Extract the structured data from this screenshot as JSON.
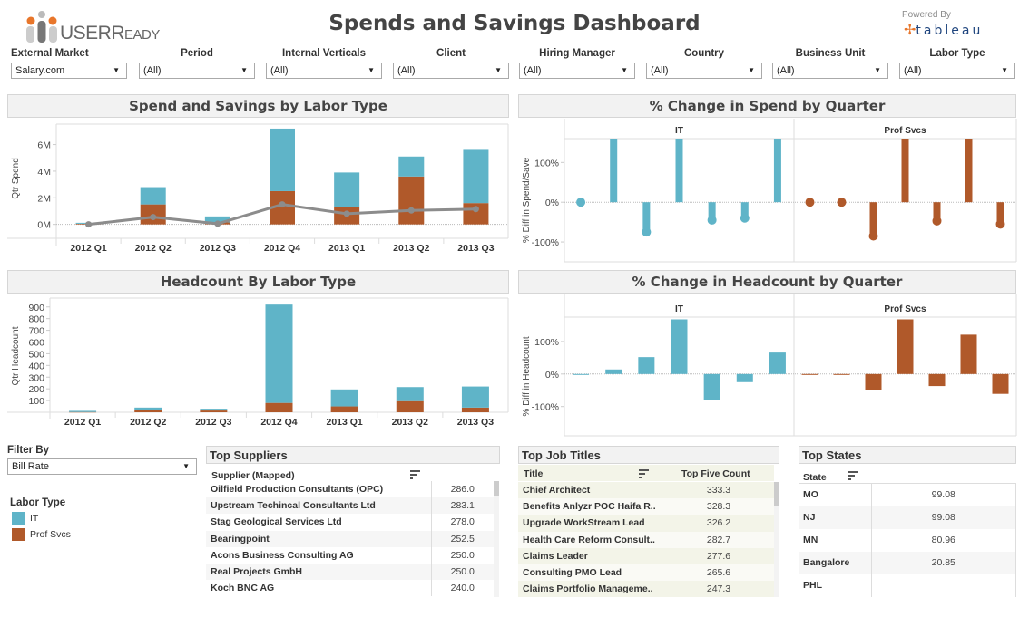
{
  "header": {
    "logo_main": "USER",
    "logo_sub": "EADY",
    "logo_r": "R",
    "title": "Spends and Savings Dashboard",
    "powered_by": "Powered By",
    "tableau_text": "tableau"
  },
  "filters": [
    {
      "label": "External Market",
      "value": "Salary.com"
    },
    {
      "label": "Period",
      "value": "(All)"
    },
    {
      "label": "Internal Verticals",
      "value": "(All)"
    },
    {
      "label": "Client",
      "value": "(All)"
    },
    {
      "label": "Hiring Manager",
      "value": "(All)"
    },
    {
      "label": "Country",
      "value": "(All)"
    },
    {
      "label": "Business Unit",
      "value": "(All)"
    },
    {
      "label": "Labor Type",
      "value": "(All)"
    }
  ],
  "colors": {
    "IT": "#5fb4c8",
    "Prof Svcs": "#b0592a",
    "line": "#8c8c8c"
  },
  "panels": {
    "spend_title": "Spend and Savings by Labor Type",
    "pct_spend_title": "% Change in Spend by Quarter",
    "headcount_title": "Headcount By Labor Type",
    "pct_headcount_title": "% Change in Headcount by Quarter"
  },
  "chart_data": [
    {
      "id": "spend",
      "type": "bar",
      "stacked": true,
      "title": "Spend and Savings by Labor Type",
      "ylabel": "Qtr Spend",
      "xlabel": "",
      "categories": [
        "2012 Q1",
        "2012 Q2",
        "2012 Q3",
        "2012 Q4",
        "2013 Q1",
        "2013 Q2",
        "2013 Q3"
      ],
      "series": [
        {
          "name": "Prof Svcs",
          "values": [
            0.05,
            1.5,
            0.15,
            2.5,
            1.3,
            3.6,
            1.6
          ]
        },
        {
          "name": "IT",
          "values": [
            0.07,
            1.3,
            0.45,
            4.7,
            2.6,
            1.5,
            4.0
          ]
        }
      ],
      "line_series": {
        "name": "Savings",
        "values": [
          0.0,
          0.55,
          0.05,
          1.5,
          0.8,
          1.05,
          1.15
        ]
      },
      "yticks": [
        0,
        2,
        4,
        6
      ],
      "ytick_labels": [
        "0M",
        "2M",
        "4M",
        "6M"
      ],
      "ylim": [
        -0.5,
        7.4
      ]
    },
    {
      "id": "pct_spend",
      "type": "bar",
      "title": "% Change in Spend by Quarter",
      "ylabel": "% Diff in Spend/Save",
      "facets": [
        "IT",
        "Prof Svcs"
      ],
      "categories": [
        "2012 Q1",
        "2012 Q2",
        "2012 Q3",
        "2012 Q4",
        "2013 Q1",
        "2013 Q2",
        "2013 Q3"
      ],
      "series": [
        {
          "name": "IT",
          "values": [
            0,
            160,
            -75,
            160,
            -45,
            -40,
            160
          ]
        },
        {
          "name": "Prof Svcs",
          "values": [
            0,
            0,
            -85,
            160,
            -47,
            160,
            -55
          ]
        }
      ],
      "yticks": [
        -100,
        0,
        100
      ],
      "ytick_labels": [
        "-100%",
        "0%",
        "100%"
      ],
      "ylim": [
        -150,
        160
      ]
    },
    {
      "id": "headcount",
      "type": "bar",
      "stacked": true,
      "title": "Headcount By Labor Type",
      "ylabel": "Qtr Headcount",
      "categories": [
        "2012 Q1",
        "2012 Q2",
        "2012 Q3",
        "2012 Q4",
        "2013 Q1",
        "2013 Q2",
        "2013 Q3"
      ],
      "series": [
        {
          "name": "Prof Svcs",
          "values": [
            2,
            20,
            15,
            80,
            50,
            95,
            40
          ]
        },
        {
          "name": "IT",
          "values": [
            10,
            20,
            15,
            840,
            145,
            120,
            180
          ]
        }
      ],
      "yticks": [
        100,
        200,
        300,
        400,
        500,
        600,
        700,
        800,
        900
      ],
      "ytick_labels": [
        "100",
        "200",
        "300",
        "400",
        "500",
        "600",
        "700",
        "800",
        "900"
      ],
      "ylim": [
        0,
        960
      ]
    },
    {
      "id": "pct_headcount",
      "type": "bar",
      "title": "% Change in Headcount by Quarter",
      "ylabel": "% Diff in Headcount",
      "facets": [
        "IT",
        "Prof Svcs"
      ],
      "categories": [
        "2012 Q1",
        "2012 Q2",
        "2012 Q3",
        "2012 Q4",
        "2013 Q1",
        "2013 Q2",
        "2013 Q3"
      ],
      "series": [
        {
          "name": "IT",
          "values": [
            -2,
            14,
            52,
            168,
            -80,
            -25,
            66
          ]
        },
        {
          "name": "Prof Svcs",
          "values": [
            -2,
            -2,
            -50,
            168,
            -37,
            121,
            -61
          ]
        }
      ],
      "yticks": [
        -100,
        0,
        100
      ],
      "ytick_labels": [
        "-100%",
        "0%",
        "100%"
      ],
      "ylim": [
        -190,
        175
      ]
    }
  ],
  "filter_by": {
    "label": "Filter By",
    "value": "Bill Rate"
  },
  "legend": {
    "title": "Labor Type",
    "items": [
      {
        "name": "IT"
      },
      {
        "name": "Prof Svcs"
      }
    ]
  },
  "top_suppliers": {
    "title": "Top Suppliers",
    "column": "Supplier (Mapped)",
    "rows": [
      {
        "name": "Oilfield Production Consultants (OPC)",
        "value": "286.0"
      },
      {
        "name": "Upstream Techincal Consultants Ltd",
        "value": "283.1"
      },
      {
        "name": "Stag Geological Services Ltd",
        "value": "278.0"
      },
      {
        "name": "Bearingpoint",
        "value": "252.5"
      },
      {
        "name": "Acons Business Consulting AG",
        "value": "250.0"
      },
      {
        "name": "Real Projects GmbH",
        "value": "250.0"
      },
      {
        "name": "Koch BNC AG",
        "value": "240.0"
      }
    ]
  },
  "top_job_titles": {
    "title": "Top Job Titles",
    "column": "Title",
    "value_column": "Top Five Count",
    "rows": [
      {
        "name": "Chief Architect",
        "value": "333.3"
      },
      {
        "name": "Benefits Anlyzr POC Haifa R..",
        "value": "328.3"
      },
      {
        "name": "Upgrade WorkStream Lead",
        "value": "326.2"
      },
      {
        "name": "Health Care Reform Consult..",
        "value": "282.7"
      },
      {
        "name": "Claims Leader",
        "value": "277.6"
      },
      {
        "name": "Consulting PMO Lead",
        "value": "265.6"
      },
      {
        "name": "Claims Portfolio Manageme..",
        "value": "247.3"
      }
    ]
  },
  "top_states": {
    "title": "Top States",
    "column": "State",
    "rows": [
      {
        "name": "MO",
        "value": "99.08"
      },
      {
        "name": "NJ",
        "value": "99.08"
      },
      {
        "name": "MN",
        "value": "80.96"
      },
      {
        "name": "Bangalore",
        "value": "20.85"
      },
      {
        "name": "PHL",
        "value": ""
      }
    ]
  }
}
